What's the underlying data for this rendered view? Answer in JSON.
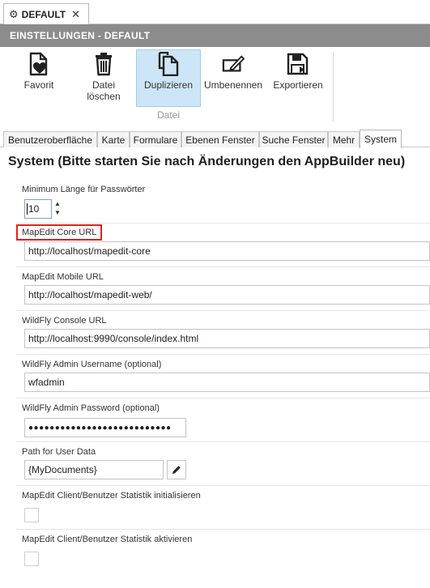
{
  "doc_tab": {
    "title": "DEFAULT",
    "icon": "gear-icon",
    "close_icon": "close-icon"
  },
  "title_bar": {
    "text": "EINSTELLUNGEN - DEFAULT"
  },
  "ribbon": {
    "buttons": [
      {
        "label": "Favorit",
        "icon": "favorite-page-icon"
      },
      {
        "label": "Datei löschen",
        "icon": "trash-icon"
      },
      {
        "label": "Duplizieren",
        "icon": "duplicate-icon"
      },
      {
        "label": "Umbenennen",
        "icon": "rename-icon"
      },
      {
        "label": "Exportieren",
        "icon": "save-export-icon"
      }
    ],
    "group_label": "Datei",
    "active_button": "Duplizieren"
  },
  "tabs": [
    "Benutzeroberfläche",
    "Karte",
    "Formulare",
    "Ebenen Fenster",
    "Suche Fenster",
    "Mehr",
    "System"
  ],
  "selected_tab": "System",
  "heading": "System (Bitte starten Sie nach Änderungen den AppBuilder neu)",
  "settings": {
    "min_password_length": {
      "label": "Minimum Länge für Passwörter",
      "value": "10"
    },
    "core_url": {
      "label": "MapEdit Core URL",
      "value": "http://localhost/mapedit-core"
    },
    "mobile_url": {
      "label": "MapEdit Mobile URL",
      "value": "http://localhost/mapedit-web/"
    },
    "wildfly_console": {
      "label": "WildFly Console URL",
      "value": "http://localhost:9990/console/index.html"
    },
    "wildfly_user": {
      "label": "WildFly Admin Username (optional)",
      "value": "wfadmin"
    },
    "wildfly_password": {
      "label": "WildFly Admin Password (optional)",
      "value": "●●●●●●●●●●●●●●●●●●●●●●●●●●●"
    },
    "user_data_path": {
      "label": "Path for User Data",
      "value": "{MyDocuments}",
      "edit_icon": "pencil-icon"
    },
    "stats_init": {
      "label": "MapEdit Client/Benutzer Statistik initialisieren",
      "checked": false
    },
    "stats_active": {
      "label": "MapEdit Client/Benutzer Statistik aktivieren",
      "checked": false
    }
  },
  "colors": {
    "title_bar": "#8c8c8c",
    "active_ribbon": "#cde6f7",
    "highlight_box": "#e02020"
  }
}
